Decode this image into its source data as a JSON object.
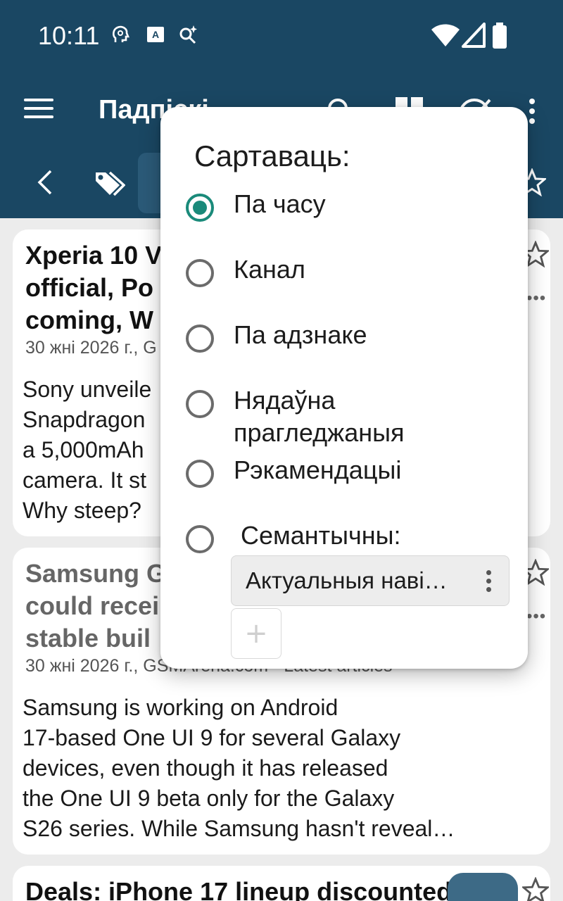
{
  "status_bar": {
    "time": "10:11"
  },
  "app_bar": {
    "title": "Падпіскі"
  },
  "cards": [
    {
      "title": "Xperia 10 V\nofficial, Po\ncoming, W",
      "meta": "30 жні 2026 г., G",
      "body": "Sony unveile\nSnapdragon\na 5,000mAh\ncamera. It st\nWhy steep?"
    },
    {
      "title": "Samsung G\ncould recei\nstable buil",
      "meta": "30 жні 2026 г., GSMArena.com - Latest articles",
      "body": "Samsung is working on Android\n17-based One UI 9 for several Galaxy\ndevices, even though it has released\nthe One UI 9 beta only for the Galaxy\nS26 series. While Samsung hasn't reveal…"
    },
    {
      "title": "Deals: iPhone 17 lineup discounted,"
    }
  ],
  "sort_dialog": {
    "title": "Сартаваць:",
    "options": [
      {
        "label": "Па часу",
        "selected": true
      },
      {
        "label": "Канал",
        "selected": false
      },
      {
        "label": "Па адзнаке",
        "selected": false
      },
      {
        "label": "Нядаўна прагледжаныя",
        "selected": false
      },
      {
        "label": "Рэкамендацыі",
        "selected": false
      },
      {
        "label": " Семантычны:",
        "selected": false
      }
    ],
    "semantic_model": "Актуальныя наві…",
    "add_label": "+"
  },
  "colors": {
    "primary": "#1a4763",
    "accent": "#1a8a7a",
    "card": "#ffffff",
    "background": "#ececec"
  }
}
